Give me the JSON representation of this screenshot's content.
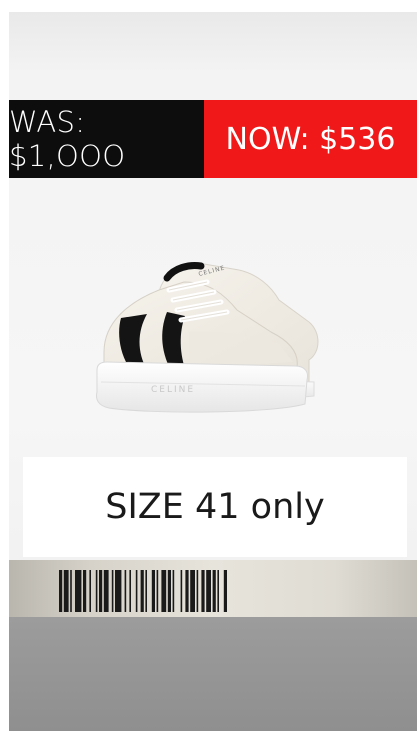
{
  "price": {
    "was_label": "WAS: $1,OOO",
    "now_label": "NOW: $536"
  },
  "product": {
    "logo_text": "CELINE",
    "image_icon": "sneaker-icon"
  },
  "size": {
    "label": "SIZE 41 only"
  },
  "barcode": {
    "icon": "barcode-icon"
  },
  "colors": {
    "was_bg": "#0d0d0d",
    "now_bg": "#f01818",
    "text_light": "#ffffff",
    "background": "#f3f3f3"
  }
}
